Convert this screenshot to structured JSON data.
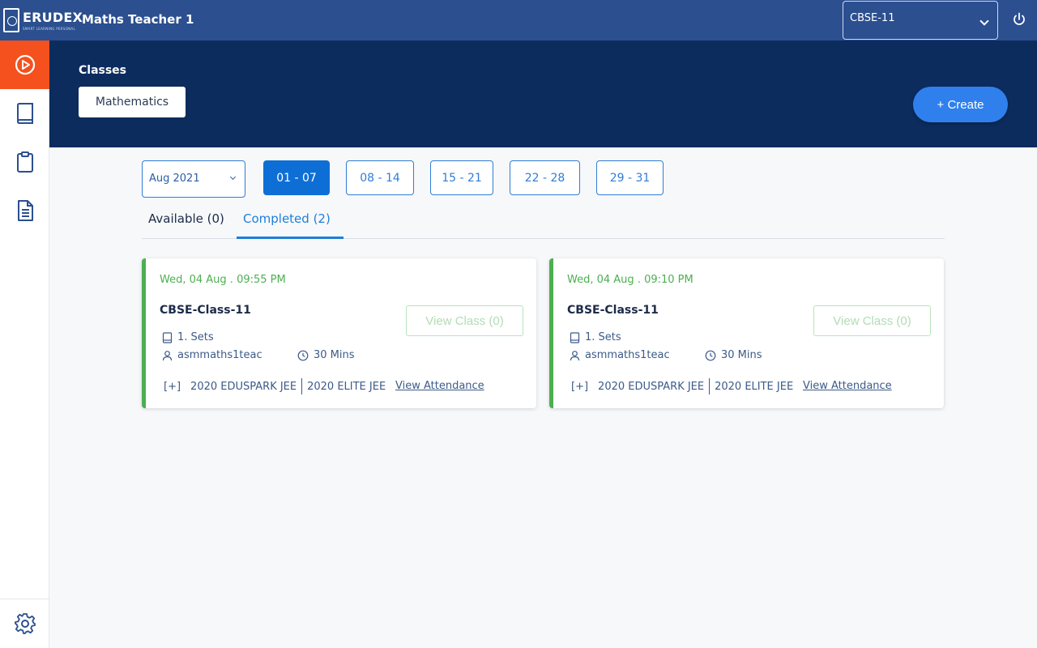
{
  "header": {
    "logo_text": "ERUDEX",
    "logo_tagline": "SMART LEARNING PERSONAL",
    "title": "Maths Teacher 1",
    "board": "CBSE-11"
  },
  "sidebar": {
    "items": [
      {
        "icon": "play-circle-icon",
        "active": true
      },
      {
        "icon": "book-icon",
        "active": false
      },
      {
        "icon": "clipboard-icon",
        "active": false
      },
      {
        "icon": "document-icon",
        "active": false
      }
    ],
    "settings_icon": "gear-icon"
  },
  "band": {
    "classes_label": "Classes",
    "subject": "Mathematics",
    "create_label": "+ Create"
  },
  "filters": {
    "month": "Aug 2021",
    "weeks": [
      "01 - 07",
      "08 - 14",
      "15 - 21",
      "22 - 28",
      "29 - 31"
    ],
    "active_week": 0
  },
  "tabs": {
    "available": "Available (0)",
    "completed": "Completed (2)",
    "active": "completed"
  },
  "cards": [
    {
      "datetime": "Wed, 04 Aug . 09:55 PM",
      "class_name": "CBSE-Class-11",
      "view_label": "View Class (0)",
      "sets": "1. Sets",
      "user": "asmmaths1teac",
      "duration": "30 Mins",
      "expand": "[+]",
      "batch1": "2020 EDUSPARK JEE",
      "batch2": "2020 ELITE JEE",
      "attendance_label": "View Attendance"
    },
    {
      "datetime": "Wed, 04 Aug . 09:10 PM",
      "class_name": "CBSE-Class-11",
      "view_label": "View Class (0)",
      "sets": "1. Sets",
      "user": "asmmaths1teac",
      "duration": "30 Mins",
      "expand": "[+]",
      "batch1": "2020 EDUSPARK JEE",
      "batch2": "2020 ELITE JEE",
      "attendance_label": "View Attendance"
    }
  ],
  "colors": {
    "topbar": "#2b4f8f",
    "band": "#0c2c5e",
    "accent": "#f4511e",
    "primary": "#2f80ed",
    "success": "#4caf50"
  }
}
